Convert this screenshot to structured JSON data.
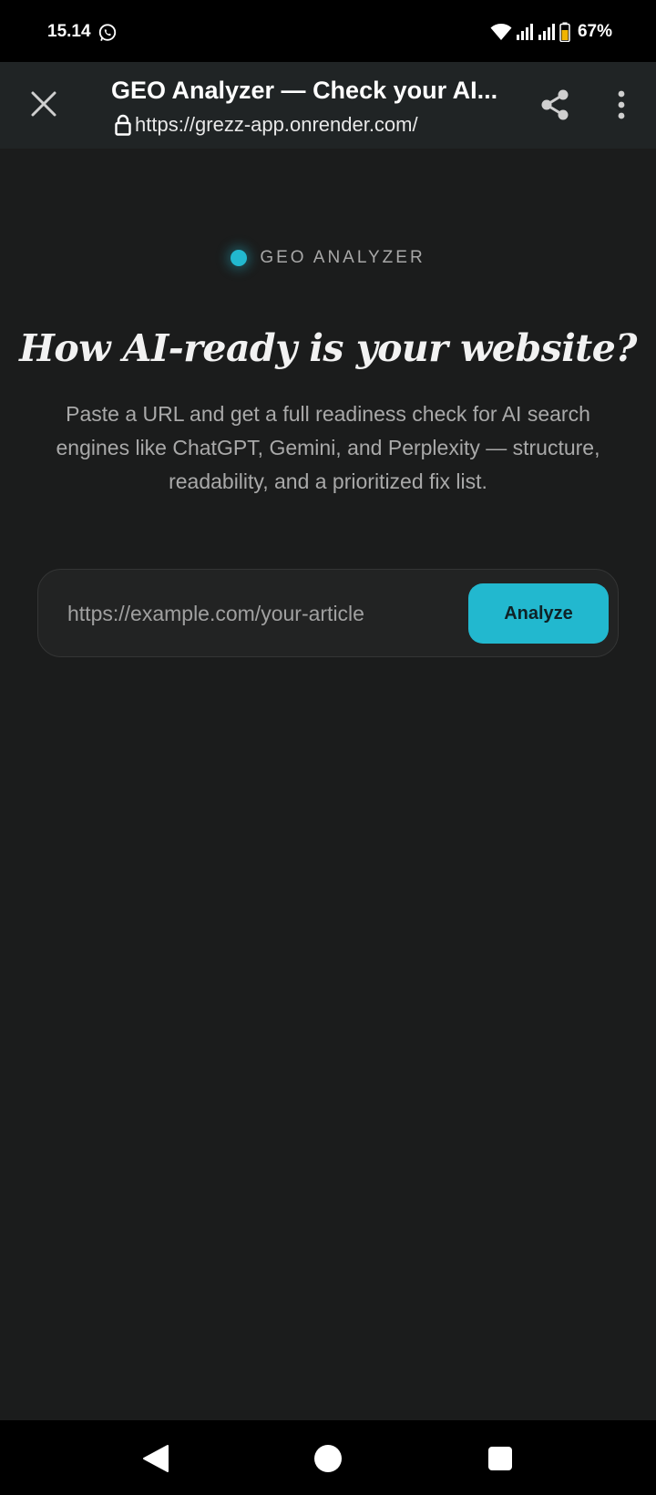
{
  "status_bar": {
    "time": "15.14",
    "battery": "67%",
    "icons": [
      "whatsapp-icon",
      "wifi-icon",
      "signal-icon",
      "signal-icon",
      "battery-icon"
    ]
  },
  "toolbar": {
    "title": "GEO Analyzer — Check your AI...",
    "url": "https://grezz-app.onrender.com/",
    "icons": [
      "close-icon",
      "lock-icon",
      "share-icon",
      "more-vert-icon"
    ]
  },
  "page": {
    "badge": "GEO ANALYZER",
    "headline": "How AI-ready is your website?",
    "subtitle": "Paste a URL and get a full readiness check for AI search engines like ChatGPT, Gemini, and Perplexity — structure, readability, and a prioritized fix list.",
    "url_placeholder": "https://example.com/your-article",
    "analyze_label": "Analyze"
  },
  "colors": {
    "accent": "#22b8cf",
    "background": "#1b1c1c",
    "toolbar": "#202425"
  },
  "nav_bar": {
    "icons": [
      "back-icon",
      "home-icon",
      "recents-icon"
    ]
  }
}
